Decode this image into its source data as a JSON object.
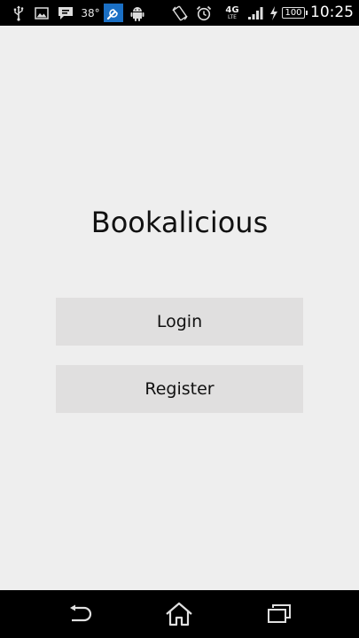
{
  "status_bar": {
    "temperature": "38°",
    "network": "4G",
    "network_sub": "LTE",
    "battery": "100",
    "time": "10:25",
    "icons": [
      "usb-icon",
      "image-icon",
      "message-icon",
      "wrench-icon",
      "android-icon",
      "rotate-icon",
      "alarm-icon",
      "signal-icon",
      "charging-icon",
      "battery-icon"
    ]
  },
  "app": {
    "title": "Bookalicious"
  },
  "buttons": {
    "login": "Login",
    "register": "Register"
  },
  "nav_bar": {
    "icons": [
      "back-icon",
      "home-icon",
      "recent-apps-icon"
    ]
  },
  "colors": {
    "background": "#eeeeee",
    "button": "#e0dfdf",
    "bars": "#000000",
    "wrench_accent": "#1a6fc4"
  }
}
